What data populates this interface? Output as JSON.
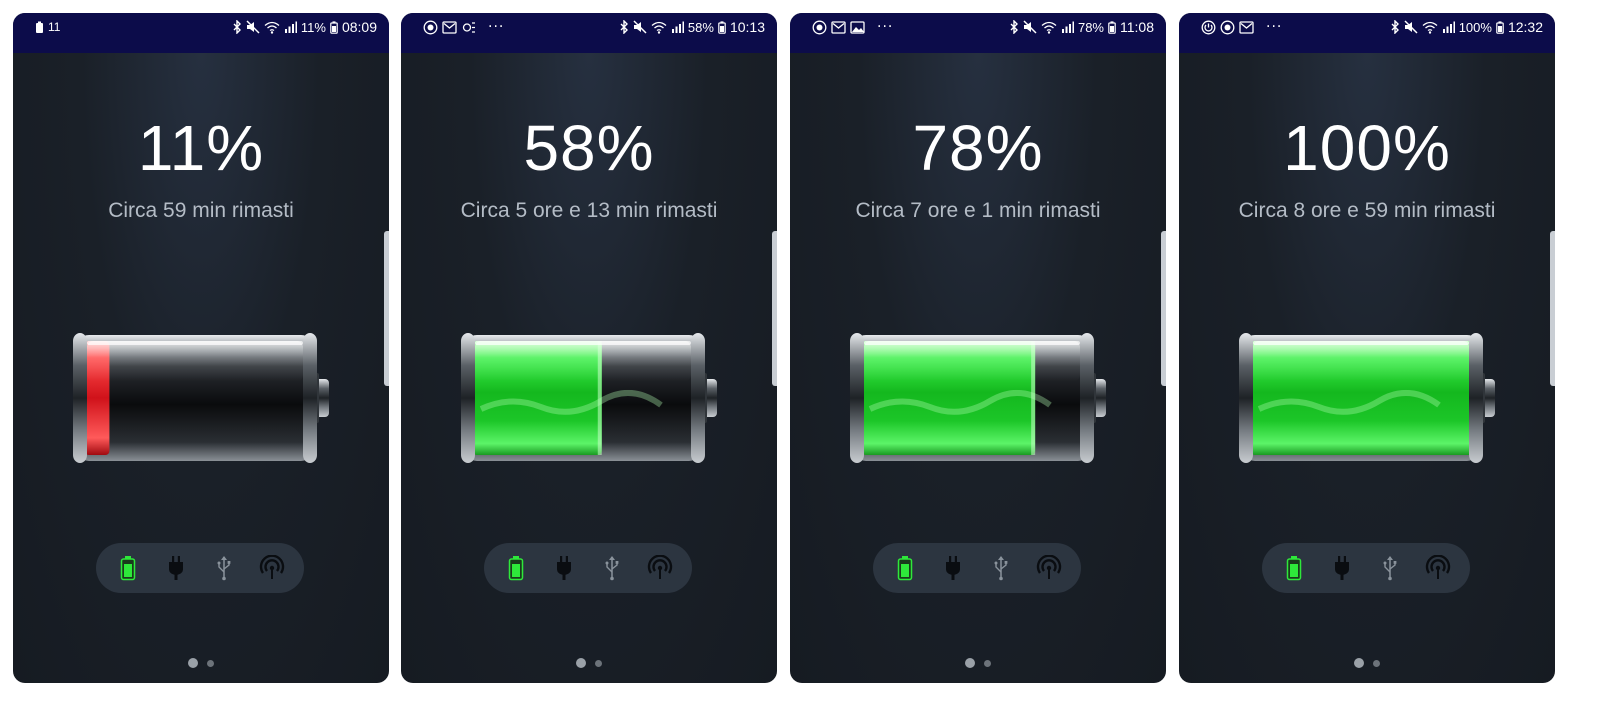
{
  "colors": {
    "statusbar": "#0c0c4a",
    "background": "#1a2028",
    "charge_green": "#2ee83a",
    "charge_red": "#e8202a",
    "tray": "#2c3540",
    "subtitle": "#b4bcc6"
  },
  "screens": [
    {
      "status": {
        "left_icons": [
          "battery-notification-icon"
        ],
        "left_text": "11",
        "battery_percent": "11%",
        "time": "08:09"
      },
      "percent_label": "11%",
      "remaining_label": "Circa 59 min rimasti",
      "charge_level": 0.11,
      "charge_color": "red"
    },
    {
      "status": {
        "left_icons": [
          "badge-58-icon",
          "mail-icon",
          "settings-notification-icon"
        ],
        "more": "···",
        "battery_percent": "58%",
        "time": "10:13"
      },
      "percent_label": "58%",
      "remaining_label": "Circa 5 ore e 13 min rimasti",
      "charge_level": 0.58,
      "charge_color": "green"
    },
    {
      "status": {
        "left_icons": [
          "badge-78-icon",
          "mail-icon",
          "image-icon"
        ],
        "more": "···",
        "battery_percent": "78%",
        "time": "11:08"
      },
      "percent_label": "78%",
      "remaining_label": "Circa 7 ore e 1 min rimasti",
      "charge_level": 0.78,
      "charge_color": "green"
    },
    {
      "status": {
        "left_icons": [
          "power-circle-icon",
          "badge-100-icon",
          "mail-icon"
        ],
        "more": "···",
        "battery_percent": "100%",
        "time": "12:32"
      },
      "percent_label": "100%",
      "remaining_label": "Circa 8 ore e 59 min rimasti",
      "charge_level": 1.0,
      "charge_color": "green"
    }
  ],
  "tray_icons": [
    "battery-icon",
    "ac-plug-icon",
    "usb-icon",
    "wireless-charging-icon"
  ],
  "page_dots": {
    "count": 2,
    "active": 0
  }
}
